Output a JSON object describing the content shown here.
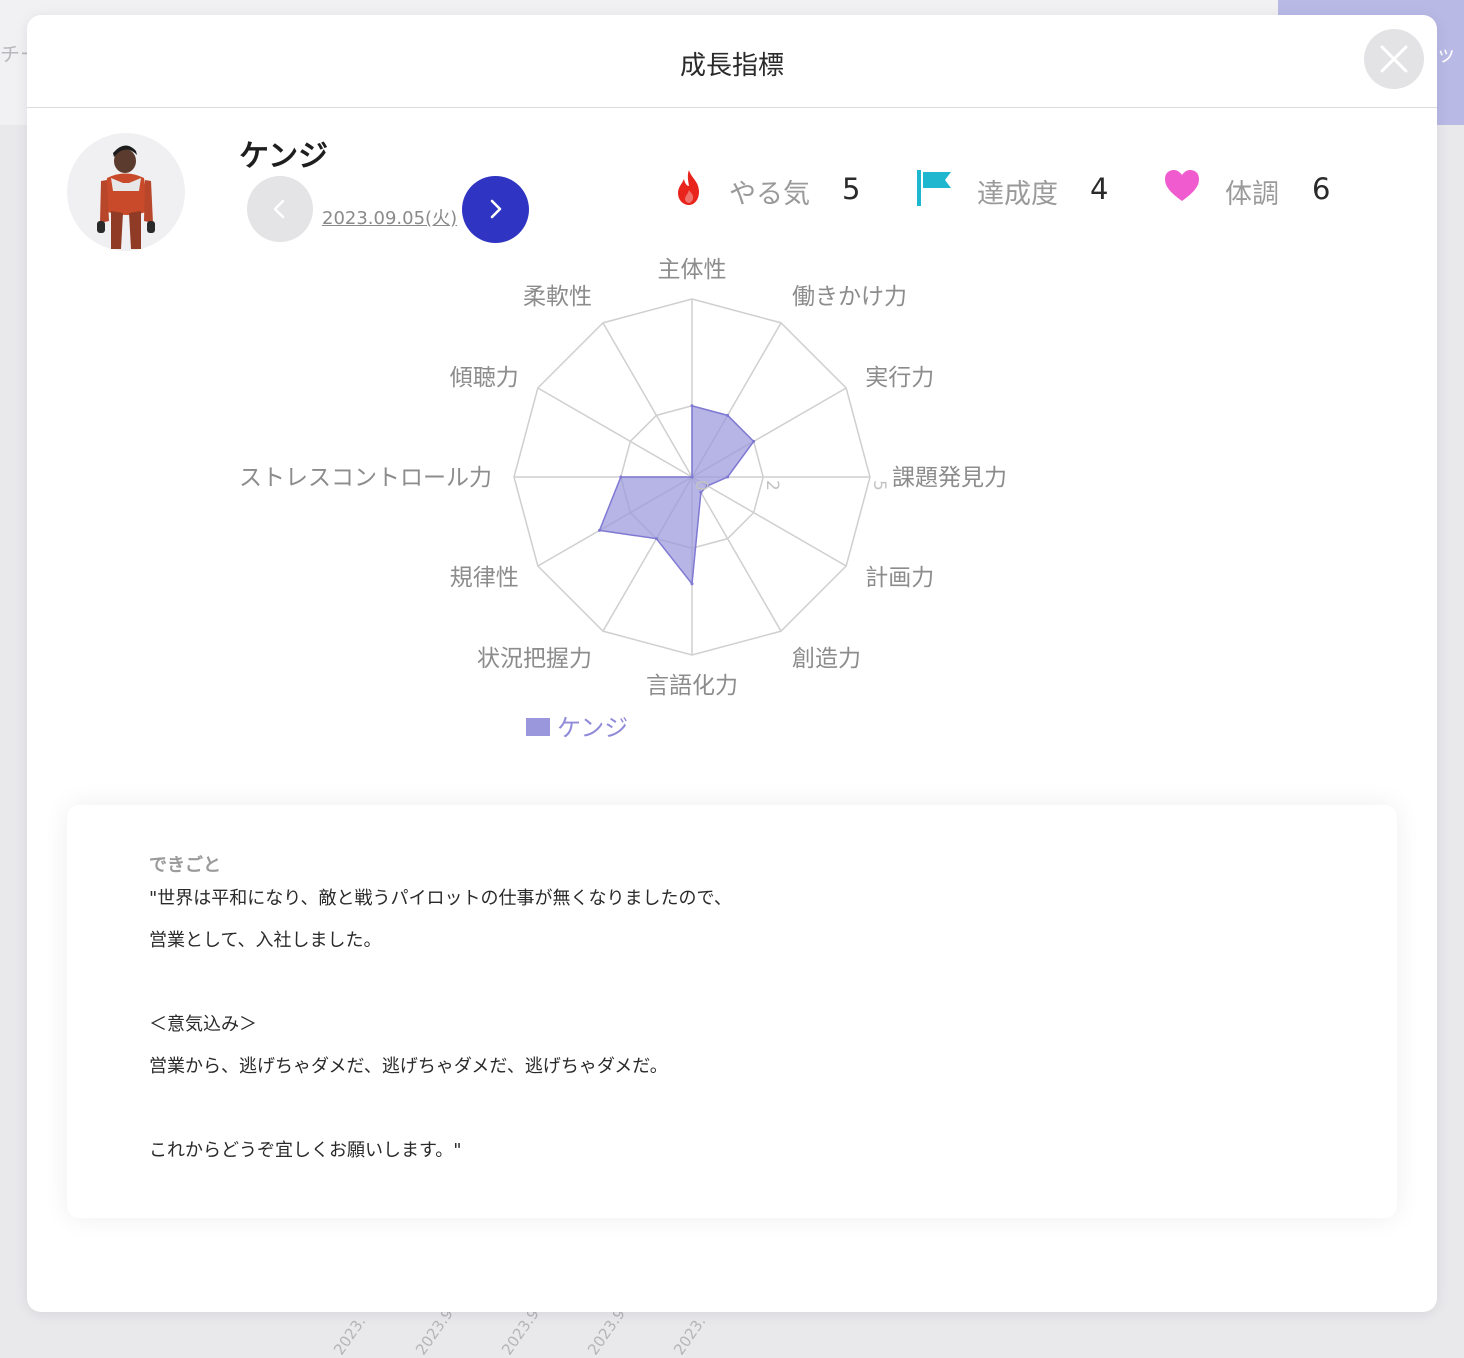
{
  "background": {
    "left_tab": "チー",
    "right_tab": "ッ",
    "ticks": [
      "2023.",
      "2023.9",
      "2023.9",
      "2023.9",
      "2023."
    ]
  },
  "modal": {
    "title": "成長指標",
    "close_icon": "close-icon"
  },
  "user": {
    "name": "ケンジ",
    "avatar_icon": "avatar-pilot"
  },
  "date_nav": {
    "date": "2023.09.05(火)",
    "prev_icon": "chevron-left-icon",
    "next_icon": "chevron-right-icon"
  },
  "metrics": [
    {
      "label": "やる気",
      "value": "5",
      "icon": "flame-icon",
      "color": "#e8241c"
    },
    {
      "label": "達成度",
      "value": "4",
      "icon": "flag-icon",
      "color": "#1fb7cf"
    },
    {
      "label": "体調",
      "value": "6",
      "icon": "heart-icon",
      "color": "#f05ccf"
    }
  ],
  "chart_data": {
    "type": "radar",
    "categories": [
      "主体性",
      "働きかけ力",
      "実行力",
      "課題発見力",
      "計画力",
      "創造力",
      "言語化力",
      "状況把握力",
      "規律性",
      "ストレスコントロール力",
      "傾聴力",
      "柔軟性"
    ],
    "series": [
      {
        "name": "ケンジ",
        "values": [
          2,
          2,
          2,
          1,
          0.5,
          0.5,
          3,
          2,
          3,
          2,
          0,
          0
        ]
      }
    ],
    "rlim": [
      0,
      5
    ],
    "tick_labels": [
      "0",
      "2",
      "5"
    ],
    "fill_color": "#9b97dd",
    "stroke_color": "#7f79d3",
    "legend_position": "bottom-left"
  },
  "legend": {
    "label": "ケンジ"
  },
  "notes": {
    "title": "できごと",
    "lines": [
      "\"世界は平和になり、敵と戦うパイロットの仕事が無くなりましたので、",
      "営業として、入社しました。",
      "",
      "＜意気込み＞",
      "営業から、逃げちゃダメだ、逃げちゃダメだ、逃げちゃダメだ。",
      "",
      "これからどうぞ宜しくお願いします。\""
    ]
  }
}
